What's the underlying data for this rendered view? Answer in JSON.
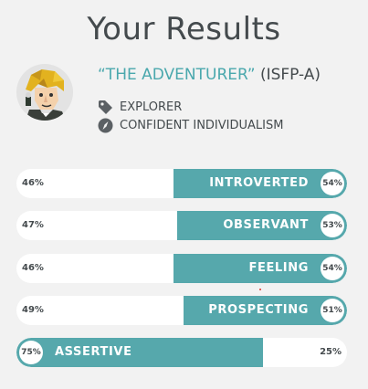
{
  "title": "Your Results",
  "type": {
    "name": "“THE ADVENTURER”",
    "code": "(ISFP-A)",
    "role": "EXPLORER",
    "strategy": "CONFIDENT INDIVIDUALISM",
    "role_icon": "tag-icon",
    "strategy_icon": "compass-icon"
  },
  "colors": {
    "accent": "#56a8ac",
    "accent_text": "#4aa8ad",
    "text": "#444a4d"
  },
  "traits": [
    {
      "label": "INTROVERTED",
      "left_pct": "46%",
      "right_pct": "54%",
      "fill_side": "right",
      "fill_fraction": 0.54
    },
    {
      "label": "OBSERVANT",
      "left_pct": "47%",
      "right_pct": "53%",
      "fill_side": "right",
      "fill_fraction": 0.53
    },
    {
      "label": "FEELING",
      "left_pct": "46%",
      "right_pct": "54%",
      "fill_side": "right",
      "fill_fraction": 0.54
    },
    {
      "label": "PROSPECTING",
      "left_pct": "49%",
      "right_pct": "51%",
      "fill_side": "right",
      "fill_fraction": 0.51
    },
    {
      "label": "ASSERTIVE",
      "left_pct": "75%",
      "right_pct": "25%",
      "fill_side": "left",
      "fill_fraction": 0.75
    }
  ]
}
